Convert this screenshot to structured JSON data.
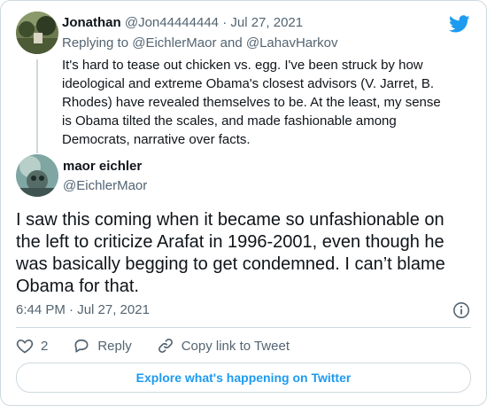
{
  "brand": {
    "accent": "#1d9bf0",
    "icon": "twitter-bird-icon"
  },
  "parent_tweet": {
    "name": "Jonathan",
    "handle": "@Jon44444444",
    "separator": "·",
    "date": "Jul 27, 2021",
    "replying_prefix": "Replying to",
    "replying_user_1": "@EichlerMaor",
    "replying_and": "and",
    "replying_user_2": "@LahavHarkov",
    "text": "It's hard to tease out chicken vs. egg. I've been struck by how ideological and extreme Obama's closest advisors (V. Jarret, B. Rhodes) have revealed themselves to be. At the least, my sense is Obama tilted the scales, and made fashionable among Democrats, narrative over facts."
  },
  "main_tweet": {
    "name": "maor eichler",
    "handle": "@EichlerMaor",
    "text": "I saw this coming when it became so unfashionable on the left to criticize Arafat in 1996-2001, even though he was basically begging to get condemned. I can’t blame Obama for that.",
    "timestamp": "6:44 PM · Jul 27, 2021"
  },
  "actions": {
    "like_count": "2",
    "reply_label": "Reply",
    "copy_link_label": "Copy link to Tweet"
  },
  "explore_label": "Explore what's happening on Twitter"
}
